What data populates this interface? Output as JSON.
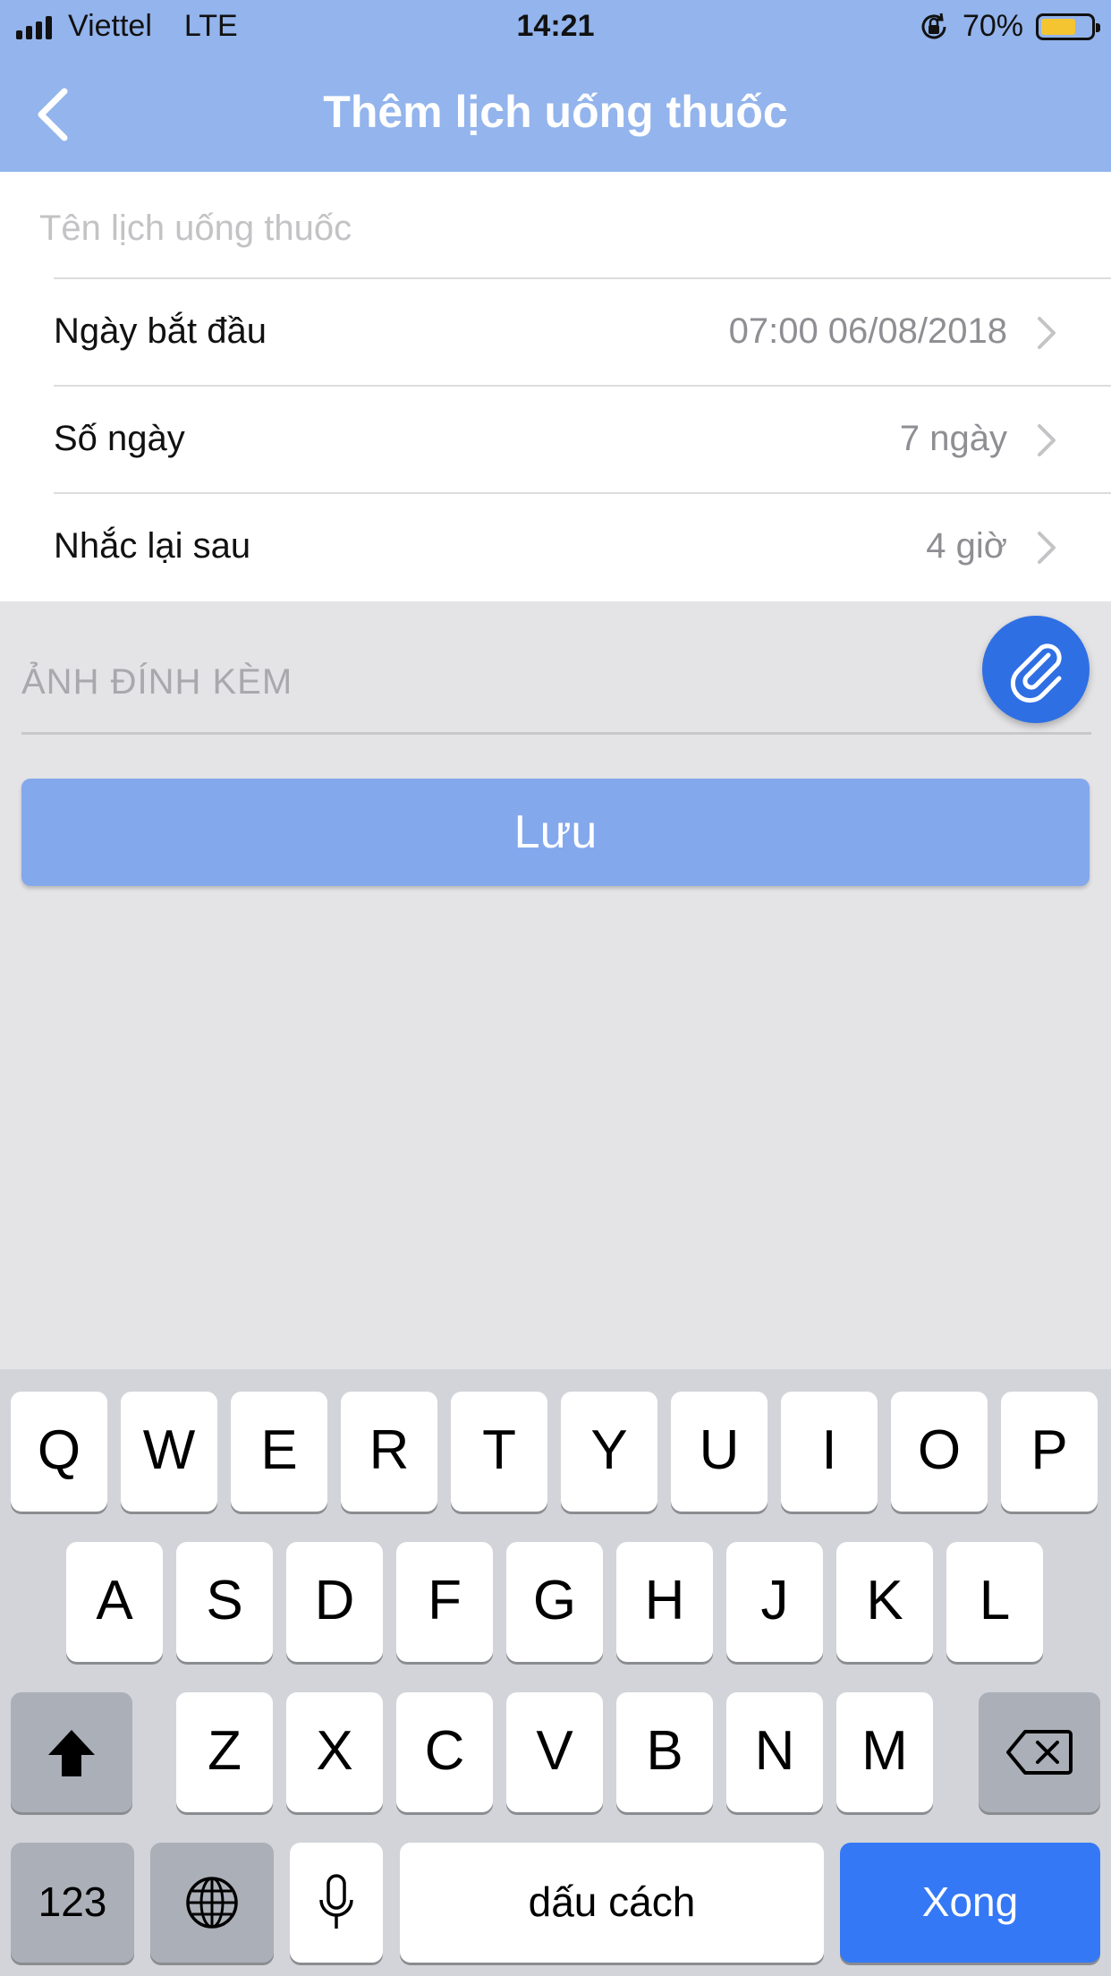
{
  "status_bar": {
    "carrier": "Viettel",
    "network": "LTE",
    "time": "14:21",
    "battery_percent": "70%",
    "battery_level": 0.7,
    "battery_color": "#f4c531"
  },
  "nav": {
    "title": "Thêm lịch uống thuốc",
    "back_icon": "chevron-left-icon",
    "background": "#93b4ec"
  },
  "form": {
    "name_placeholder": "Tên lịch uống thuốc",
    "name_value": "",
    "rows": [
      {
        "label": "Ngày bắt đầu",
        "value": "07:00 06/08/2018"
      },
      {
        "label": "Số ngày",
        "value": "7 ngày"
      },
      {
        "label": "Nhắc lại sau",
        "value": "4 giờ"
      }
    ]
  },
  "attachment": {
    "label": "ẢNH ĐÍNH KÈM",
    "button_icon": "paperclip-icon",
    "button_color": "#2f6fe4"
  },
  "save_button": {
    "label": "Lưu",
    "color": "#84a8ec"
  },
  "keyboard": {
    "row1": [
      "Q",
      "W",
      "E",
      "R",
      "T",
      "Y",
      "U",
      "I",
      "O",
      "P"
    ],
    "row2": [
      "A",
      "S",
      "D",
      "F",
      "G",
      "H",
      "J",
      "K",
      "L"
    ],
    "row3": [
      "Z",
      "X",
      "C",
      "V",
      "B",
      "N",
      "M"
    ],
    "numbers_key": "123",
    "space_key": "dấu cách",
    "done_key": "Xong",
    "done_color": "#3478f6"
  }
}
